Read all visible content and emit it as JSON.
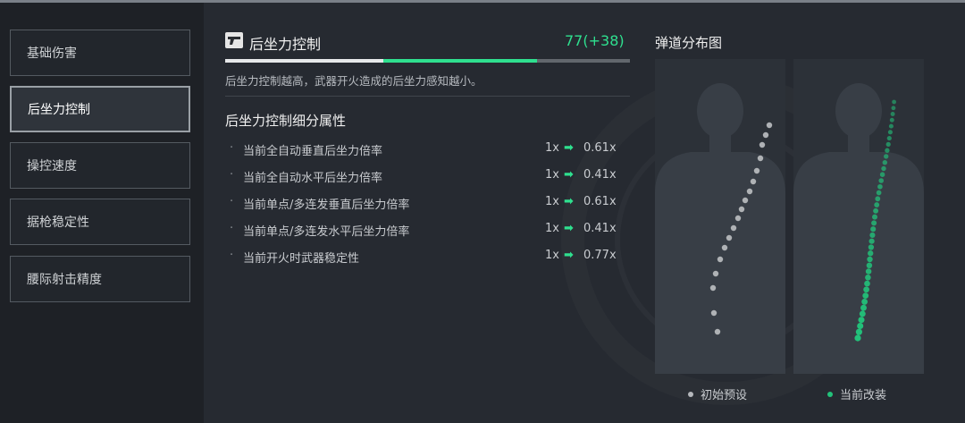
{
  "sidebar": {
    "items": [
      {
        "label": "基础伤害",
        "active": false
      },
      {
        "label": "后坐力控制",
        "active": true
      },
      {
        "label": "操控速度",
        "active": false
      },
      {
        "label": "据枪稳定性",
        "active": false
      },
      {
        "label": "腰际射击精度",
        "active": false
      }
    ]
  },
  "section": {
    "icon": "pistol-icon",
    "title": "后坐力控制",
    "score": "77(+38)",
    "level": 0.77,
    "bonus": 0.38,
    "description": "后坐力控制越高，武器开火造成的后坐力感知越小。"
  },
  "attributes": {
    "title": "后坐力控制细分属性",
    "bullet": "·",
    "arrow": "➡",
    "rows": [
      {
        "name": "当前全自动垂直后坐力倍率",
        "from": "1x",
        "to": "0.61x"
      },
      {
        "name": "当前全自动水平后坐力倍率",
        "from": "1x",
        "to": "0.41x"
      },
      {
        "name": "当前单点/多连发垂直后坐力倍率",
        "from": "1x",
        "to": "0.61x"
      },
      {
        "name": "当前单点/多连发水平后坐力倍率",
        "from": "1x",
        "to": "0.41x"
      },
      {
        "name": "当前开火时武器稳定性",
        "from": "1x",
        "to": "0.77x"
      }
    ]
  },
  "trajectory": {
    "title": "弹道分布图",
    "legend": [
      {
        "label": "初始预设",
        "color": "#b5b8bc"
      },
      {
        "label": "当前改装",
        "color": "#22c27a"
      }
    ]
  },
  "colors": {
    "accent": "#2fe08f",
    "initial_dots": "#b5b8bc",
    "modded_dots": "#22c27a"
  }
}
